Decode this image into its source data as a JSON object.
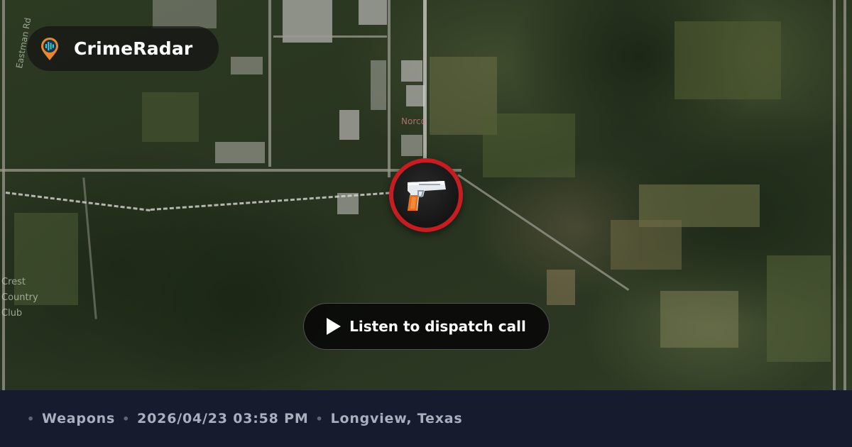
{
  "brand": {
    "name": "CrimeRadar",
    "icon": "radar-pin-icon"
  },
  "map": {
    "labels": [
      "Eastman Rd",
      "Crest",
      "Country",
      "Club",
      "Norco"
    ]
  },
  "incident": {
    "category_icon": "gun-icon",
    "marker_color": "#c51d22"
  },
  "listen_button": {
    "label": "Listen to dispatch call",
    "icon": "play-icon"
  },
  "footer": {
    "category": "Weapons",
    "datetime": "2026/04/23 03:58 PM",
    "location": "Longview, Texas",
    "separator": "•"
  }
}
